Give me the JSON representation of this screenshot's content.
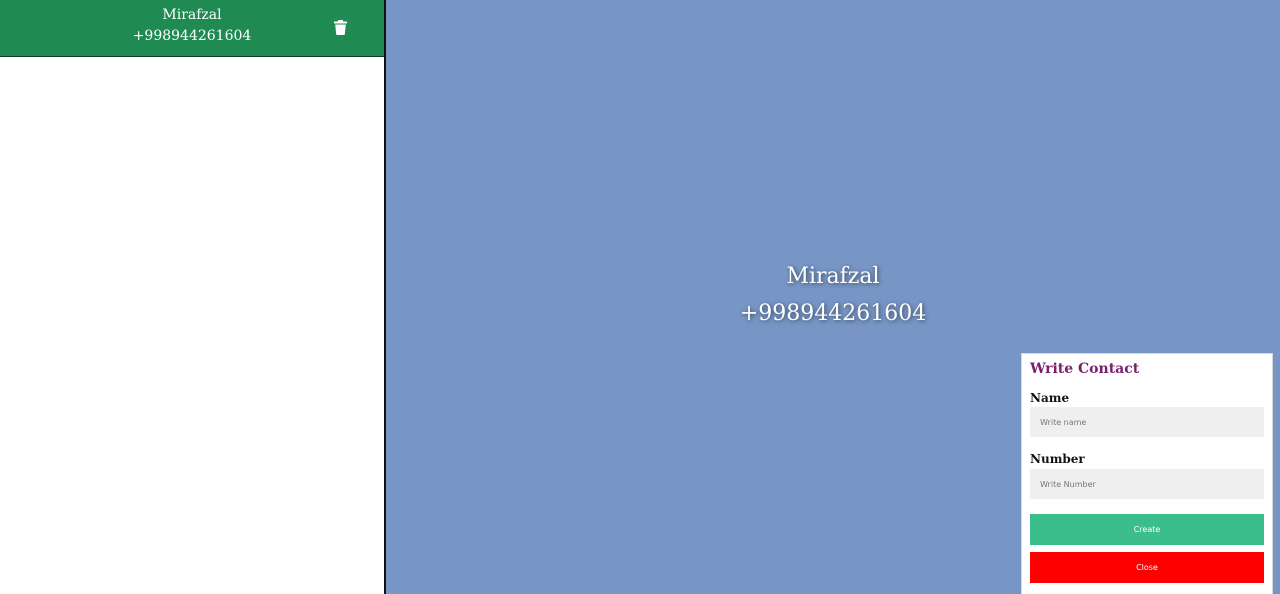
{
  "contacts": [
    {
      "name": "Mirafzal",
      "number": "+998944261604"
    }
  ],
  "selected_contact": {
    "name": "Mirafzal",
    "number": "+998944261604"
  },
  "form": {
    "title": "Write Contact",
    "name_label": "Name",
    "name_placeholder": "Write name",
    "name_value": "",
    "number_label": "Number",
    "number_placeholder": "Write Number",
    "number_value": "",
    "create_label": "Create",
    "close_label": "Close"
  },
  "icons": {
    "delete": "trash-icon"
  },
  "colors": {
    "contact_item_bg": "#1f8a52",
    "main_bg": "#7795c5",
    "form_title": "#7a1f6e",
    "create_button": "#3bbd8c",
    "close_button": "#ff0000"
  }
}
